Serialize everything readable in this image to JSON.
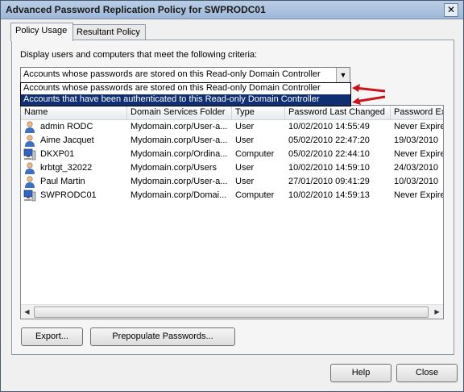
{
  "window": {
    "title": "Advanced Password Replication Policy for SWPRODC01",
    "close_glyph": "✕"
  },
  "tabs": [
    {
      "label": "Policy Usage",
      "active": true
    },
    {
      "label": "Resultant Policy",
      "active": false
    }
  ],
  "criteria_label": "Display users and computers that meet the following criteria:",
  "filter": {
    "selected": "Accounts whose passwords are stored on this Read-only Domain Controller",
    "options": [
      "Accounts whose passwords are stored on this Read-only Domain Controller",
      "Accounts that have been authenticated to this Read-only Domain Controller"
    ],
    "highlighted_index": 1
  },
  "columns": [
    "Name",
    "Domain Services Folder",
    "Type",
    "Password Last Changed",
    "Password Ex"
  ],
  "rows": [
    {
      "icon": "user-icon",
      "name": "admin RODC",
      "folder": "Mydomain.corp/User-a...",
      "type": "User",
      "changed": "10/02/2010 14:55:49",
      "expires": "Never Expire"
    },
    {
      "icon": "user-icon",
      "name": "Aime Jacquet",
      "folder": "Mydomain.corp/User-a...",
      "type": "User",
      "changed": "05/02/2010 22:47:20",
      "expires": "19/03/2010"
    },
    {
      "icon": "computer-icon",
      "name": "DKXP01",
      "folder": "Mydomain.corp/Ordina...",
      "type": "Computer",
      "changed": "05/02/2010 22:44:10",
      "expires": "Never Expire"
    },
    {
      "icon": "user-icon",
      "name": "krbtgt_32022",
      "folder": "Mydomain.corp/Users",
      "type": "User",
      "changed": "10/02/2010 14:59:10",
      "expires": "24/03/2010"
    },
    {
      "icon": "user-icon",
      "name": "Paul Martin",
      "folder": "Mydomain.corp/User-a...",
      "type": "User",
      "changed": "27/01/2010 09:41:29",
      "expires": "10/03/2010"
    },
    {
      "icon": "computer-icon",
      "name": "SWPRODC01",
      "folder": "Mydomain.corp/Domai...",
      "type": "Computer",
      "changed": "10/02/2010 14:59:13",
      "expires": "Never Expire"
    }
  ],
  "buttons": {
    "export": "Export...",
    "prepopulate": "Prepopulate Passwords...",
    "help": "Help",
    "close": "Close"
  },
  "scroll": {
    "left_glyph": "◀",
    "right_glyph": "▶"
  },
  "colors": {
    "highlight": "#0f2f72",
    "annotation_arrow": "#c8141e"
  }
}
